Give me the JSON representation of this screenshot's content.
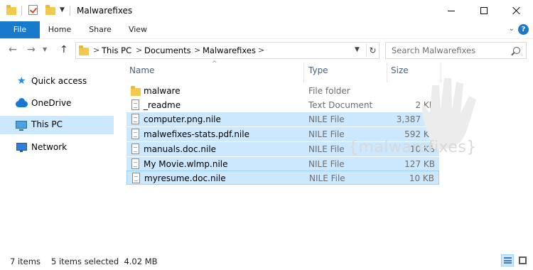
{
  "window": {
    "title": "Malwarefixes"
  },
  "ribbon": {
    "tabs": [
      {
        "label": "File",
        "active": true
      },
      {
        "label": "Home"
      },
      {
        "label": "Share"
      },
      {
        "label": "View"
      }
    ],
    "accent": "#1979ca"
  },
  "address": {
    "crumbs": [
      "This PC",
      "Documents",
      "Malwarefixes"
    ],
    "crumb_sep": ">"
  },
  "search": {
    "placeholder": "Search Malwarefixes"
  },
  "navpane": {
    "items": [
      {
        "label": "Quick access",
        "icon": "star-icon"
      },
      {
        "label": "OneDrive",
        "icon": "cloud-icon"
      },
      {
        "label": "This PC",
        "icon": "pc-icon",
        "selected": true
      },
      {
        "label": "Network",
        "icon": "network-icon"
      }
    ]
  },
  "filelist": {
    "columns": [
      "Name",
      "Type",
      "Size"
    ],
    "rows": [
      {
        "name": "malware",
        "type": "File folder",
        "size": "",
        "icon": "folder-icon",
        "selected": false
      },
      {
        "name": "_readme",
        "type": "Text Document",
        "size": "2 KB",
        "icon": "text-file-icon",
        "selected": false
      },
      {
        "name": "computer.png.nile",
        "type": "NILE File",
        "size": "3,387 KB",
        "icon": "file-icon",
        "selected": true
      },
      {
        "name": "malwefixes-stats.pdf.nile",
        "type": "NILE File",
        "size": "592 KB",
        "icon": "file-icon",
        "selected": true
      },
      {
        "name": "manuals.doc.nile",
        "type": "NILE File",
        "size": "10 KB",
        "icon": "file-icon",
        "selected": true
      },
      {
        "name": "My Movie.wlmp.nile",
        "type": "NILE File",
        "size": "127 KB",
        "icon": "file-icon",
        "selected": true
      },
      {
        "name": "myresume.doc.nile",
        "type": "NILE File",
        "size": "10 KB",
        "icon": "file-icon",
        "selected": true
      }
    ],
    "selection_color": "#cce8ff"
  },
  "watermark": {
    "text": "{malwarefixes}"
  },
  "status": {
    "item_count": "7 items",
    "selection": "5 items selected  4.02 MB"
  }
}
